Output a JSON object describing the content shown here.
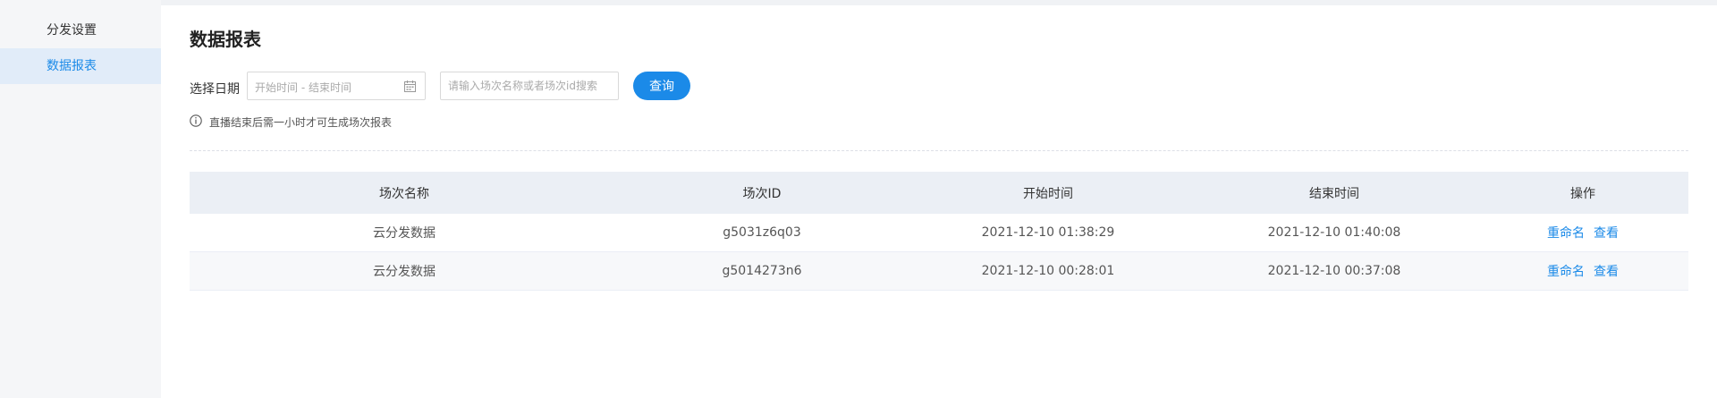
{
  "sidebar": {
    "items": [
      {
        "label": "分发设置",
        "active": false
      },
      {
        "label": "数据报表",
        "active": true
      }
    ]
  },
  "page": {
    "title": "数据报表"
  },
  "filter": {
    "date_label": "选择日期",
    "date_placeholder": "开始时间 - 结束时间",
    "search_placeholder": "请输入场次名称或者场次id搜索",
    "query_label": "查询"
  },
  "tip": {
    "text": "直播结束后需一小时才可生成场次报表"
  },
  "table": {
    "columns": [
      "场次名称",
      "场次ID",
      "开始时间",
      "结束时间",
      "操作"
    ],
    "rows": [
      {
        "name": "云分发数据",
        "id": "g5031z6q03",
        "start": "2021-12-10 01:38:29",
        "end": "2021-12-10 01:40:08",
        "actions": [
          "重命名",
          "查看"
        ]
      },
      {
        "name": "云分发数据",
        "id": "g5014273n6",
        "start": "2021-12-10 00:28:01",
        "end": "2021-12-10 00:37:08",
        "actions": [
          "重命名",
          "查看"
        ]
      }
    ]
  },
  "colors": {
    "accent": "#1b8ae8",
    "sidebar_active_bg": "#e1ecf9",
    "table_header_bg": "#ebeff5"
  },
  "icons": {
    "date": "calendar-icon",
    "tip": "info-icon"
  }
}
